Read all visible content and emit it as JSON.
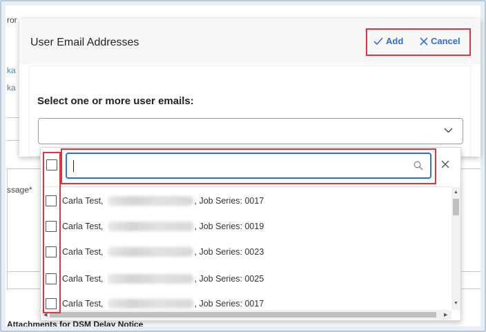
{
  "background": {
    "fragments": [
      "ror",
      "ka",
      "ka",
      "ssage*"
    ],
    "bottom_heading": "Attachments for DSM Delay Notice"
  },
  "modal": {
    "title": "User Email Addresses",
    "add_label": "Add",
    "cancel_label": "Cancel",
    "select_label": "Select one or more user emails:",
    "select_value": ""
  },
  "dropdown": {
    "search_value": "",
    "items": [
      {
        "name": "Carla Test,",
        "series": ", Job Series: 0017"
      },
      {
        "name": "Carla Test,",
        "series": ", Job Series: 0019"
      },
      {
        "name": "Carla Test,",
        "series": ", Job Series: 0023"
      },
      {
        "name": "Carla Test,",
        "series": ", Job Series: 0025"
      },
      {
        "name": "Carla Test,",
        "series": ", Job Series: 0017"
      }
    ]
  },
  "colors": {
    "accent": "#2a6fd3",
    "highlight": "#e0343b"
  }
}
